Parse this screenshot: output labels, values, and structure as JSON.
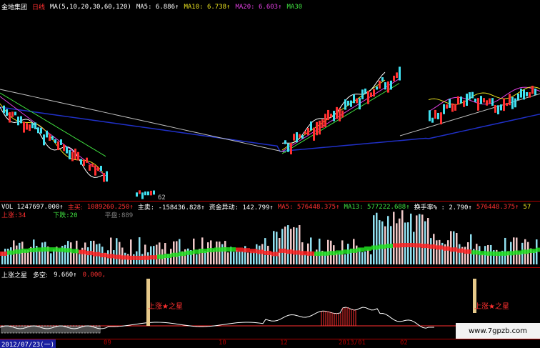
{
  "price_header": {
    "stock_name": "金地集团",
    "period": "日线",
    "ma_params": "MA(5,10,20,30,60,120)",
    "ma5": "MA5: 6.886↑",
    "ma10": "MA10: 6.738↑",
    "ma20": "MA20: 6.603↑",
    "ma30": "MA30"
  },
  "price_annotation": "62",
  "vol_header": {
    "vol": "VOL 1247697.000↑",
    "main_buy_label": "主买:",
    "main_buy_value": "1089260.250↑",
    "main_sell": "主卖: -158436.828↑",
    "fund_flow": "资金异动: 142.799↑",
    "ma5": "MA5: 576448.375↑",
    "ma13": "MA13: 577222.688↑",
    "turnover": "换手率% : 2.790↑",
    "extra": "576448.375↑",
    "extra2": "57"
  },
  "vol_stats": {
    "up": "上涨:34",
    "down": "下跌:20",
    "flat": "平盘:889"
  },
  "indicator_header": {
    "name": "上涨之星",
    "label": "多空:",
    "value": "9.660↑",
    "value2": "0.000,"
  },
  "signals": {
    "label1": "上涨★之星",
    "label2": "上涨★之星"
  },
  "footer": {
    "date": "2012/07/23(一)",
    "tick_09": "09",
    "tick_10": "10",
    "tick_12": "12",
    "tick_2013": "2013/01",
    "tick_02": "02"
  },
  "watermark": "www.7gpzb.com",
  "colors": {
    "background": "#000000",
    "up": "#ff3030",
    "down": "#40e0f0",
    "ma5": "#ffffff",
    "ma10": "#e8e020",
    "ma20": "#e040e0",
    "ma30": "#40e040",
    "ma60": "#c0c0c0",
    "ma120": "#2030c8"
  }
}
